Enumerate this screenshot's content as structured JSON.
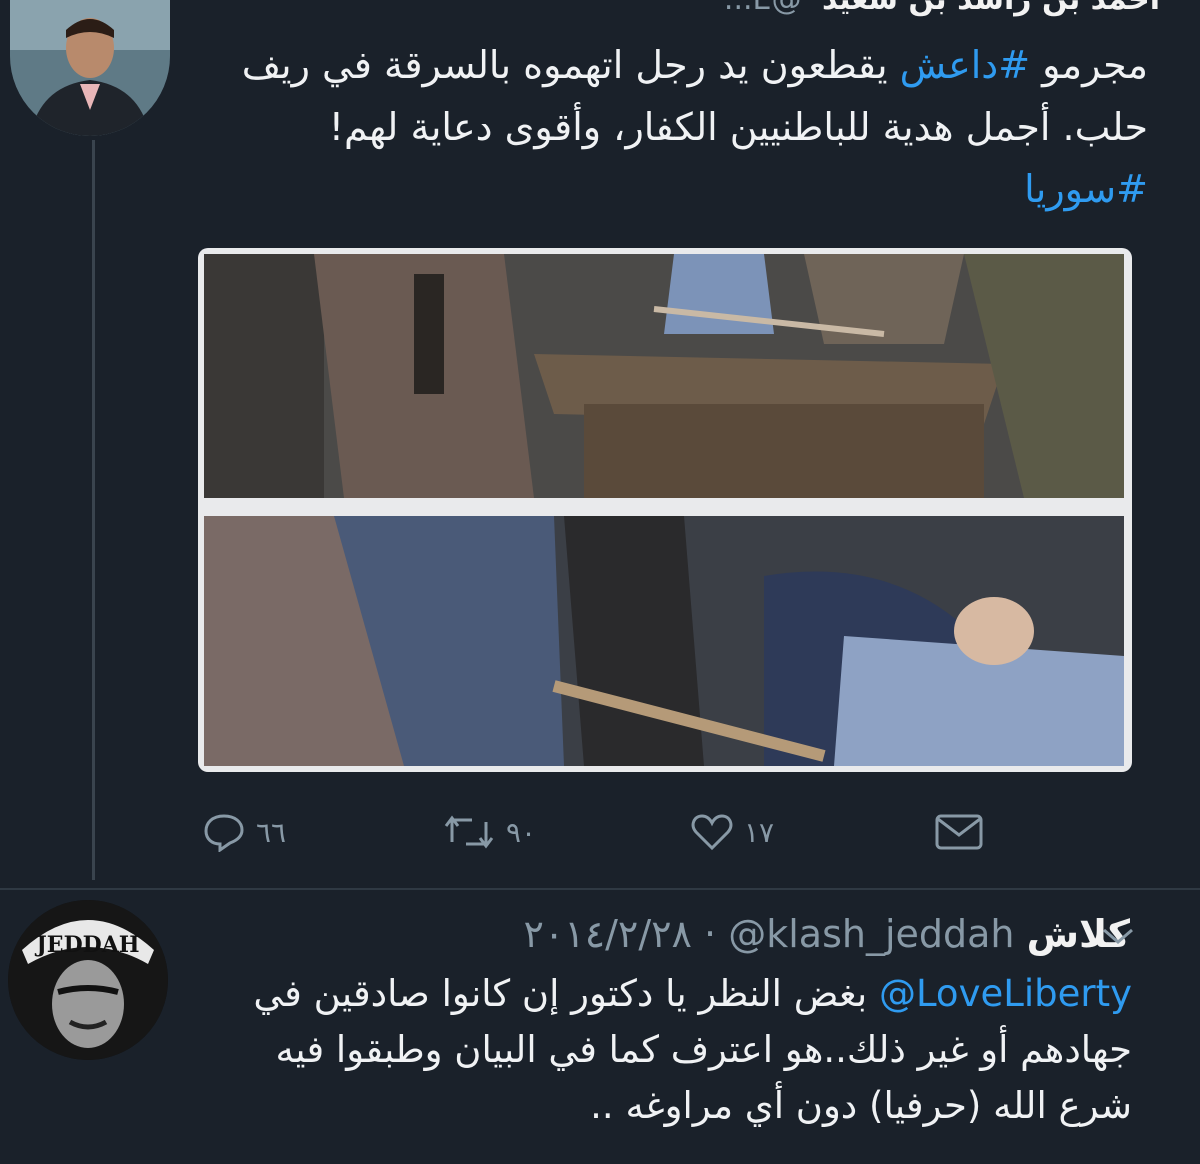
{
  "tweet1": {
    "header_name": "أحمد بن راشد بن سعيد",
    "header_handle": "@E...",
    "text_before_hashtag": "مجرمو ",
    "hashtag1": "#داعش",
    "text_after_hashtag": " يقطعون يد رجل اتهموه بالسرقة في ريف حلب. أجمل هدية للباطنيين الكفار، وأقوى دعاية لهم!",
    "hashtag2": "#سوريا",
    "actions": {
      "reply_count": "٦٦",
      "retweet_count": "٩٠",
      "like_count": "١٧"
    }
  },
  "tweet2": {
    "name": "كلاش",
    "handle": "@klash_jeddah",
    "separator": "·",
    "date": "٢٠١٤/٢/٢٨",
    "avatar_text": "JEDDAH",
    "mention": "@LoveLiberty",
    "text_line1_rest": " بغض النظر يا دكتور إن كانوا",
    "text_rest": "صادقين في جهادهم أو غير ذلك..هو اعترف كما في البيان وطبقوا فيه شرع الله (حرفيا) دون أي مراوغه .."
  },
  "colors": {
    "background": "#1a212a",
    "link": "#2f9bf0",
    "muted": "#8899a6",
    "text": "#f0f2f4"
  }
}
